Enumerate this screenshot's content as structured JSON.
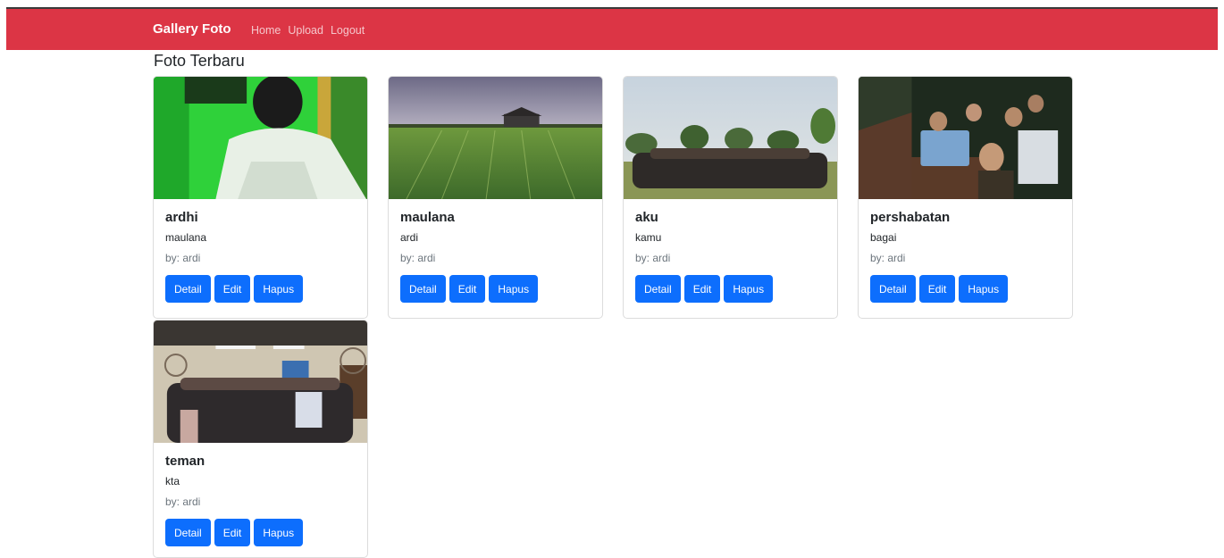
{
  "navbar": {
    "brand": "Gallery Foto",
    "links": [
      "Home",
      "Upload",
      "Logout"
    ],
    "color": "#dc3545"
  },
  "page": {
    "title": "Foto Terbaru"
  },
  "buttons": {
    "detail": "Detail",
    "edit": "Edit",
    "hapus": "Hapus",
    "color": "#0d6efd"
  },
  "photos": [
    {
      "title": "ardhi",
      "description": "maulana",
      "by": "by: ardi"
    },
    {
      "title": "maulana",
      "description": "ardi",
      "by": "by: ardi"
    },
    {
      "title": "aku",
      "description": "kamu",
      "by": "by: ardi"
    },
    {
      "title": "pershabatan",
      "description": "bagai",
      "by": "by: ardi"
    },
    {
      "title": "teman",
      "description": "kta",
      "by": "by: ardi"
    }
  ]
}
